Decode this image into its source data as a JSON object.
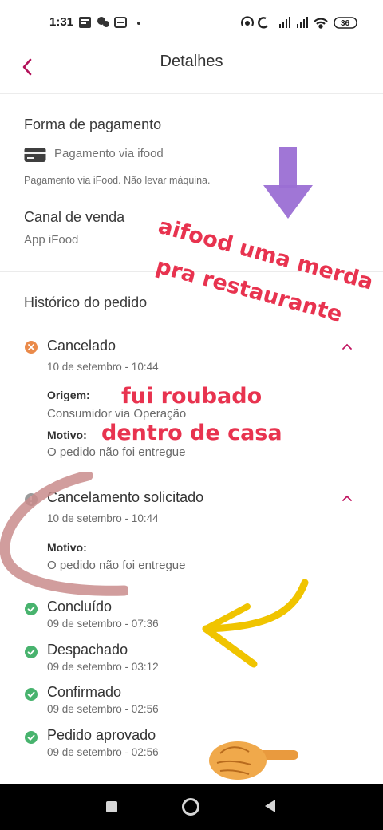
{
  "status_bar": {
    "time": "1:31",
    "left_icons": [
      "notification-icon",
      "messenger-icon",
      "vpn-icon",
      "dot-icon"
    ],
    "right_icons": [
      "hotspot-icon",
      "sync-icon",
      "signal-icon",
      "signal-icon",
      "wifi-icon",
      "battery-icon"
    ],
    "battery_level": "36"
  },
  "header": {
    "title": "Detalhes",
    "back_icon": "chevron-left-icon",
    "accent_color": "#b3125a"
  },
  "payment": {
    "title": "Forma de pagamento",
    "method": "Pagamento via ifood",
    "note": "Pagamento via iFood. Não levar máquina."
  },
  "sales_channel": {
    "title": "Canal de venda",
    "value": "App iFood"
  },
  "history": {
    "title": "Histórico do pedido",
    "events": [
      {
        "status": "Cancelado",
        "date": "10 de setembro - 10:44",
        "icon": "cancel-icon",
        "icon_color": "#ea8a4a",
        "origin_label": "Origem:",
        "origin_value": "Consumidor via Operação",
        "reason_label": "Motivo:",
        "reason_value": "O pedido não foi entregue"
      },
      {
        "status": "Cancelamento solicitado",
        "date": "10 de setembro - 10:44",
        "icon": "info-icon",
        "icon_color": "#9a9a9a",
        "reason_label": "Motivo:",
        "reason_value": "O pedido não foi entregue"
      },
      {
        "status": "Concluído",
        "date": "09 de setembro - 07:36",
        "icon": "check-icon",
        "icon_color": "#48b36e"
      },
      {
        "status": "Despachado",
        "date": "09 de setembro - 03:12",
        "icon": "check-icon",
        "icon_color": "#48b36e"
      },
      {
        "status": "Confirmado",
        "date": "09 de setembro - 02:56",
        "icon": "check-icon",
        "icon_color": "#48b36e"
      },
      {
        "status": "Pedido aprovado",
        "date": "09 de setembro - 02:56",
        "icon": "check-icon",
        "icon_color": "#48b36e"
      }
    ]
  },
  "annotations": {
    "line1": "aifood uma merda",
    "line2": "pra restaurante",
    "line3": "fui roubado",
    "line4": "dentro de casa",
    "text_color": "#e8334f",
    "arrow_down_color": "#9b6fd4",
    "arrow_left_color": "#f0c400",
    "swoosh_color": "#c98c8c",
    "hand_emoji": "pointing-hand-icon"
  },
  "nav_bar": {
    "buttons": [
      "recents-button",
      "home-button",
      "back-button"
    ]
  }
}
